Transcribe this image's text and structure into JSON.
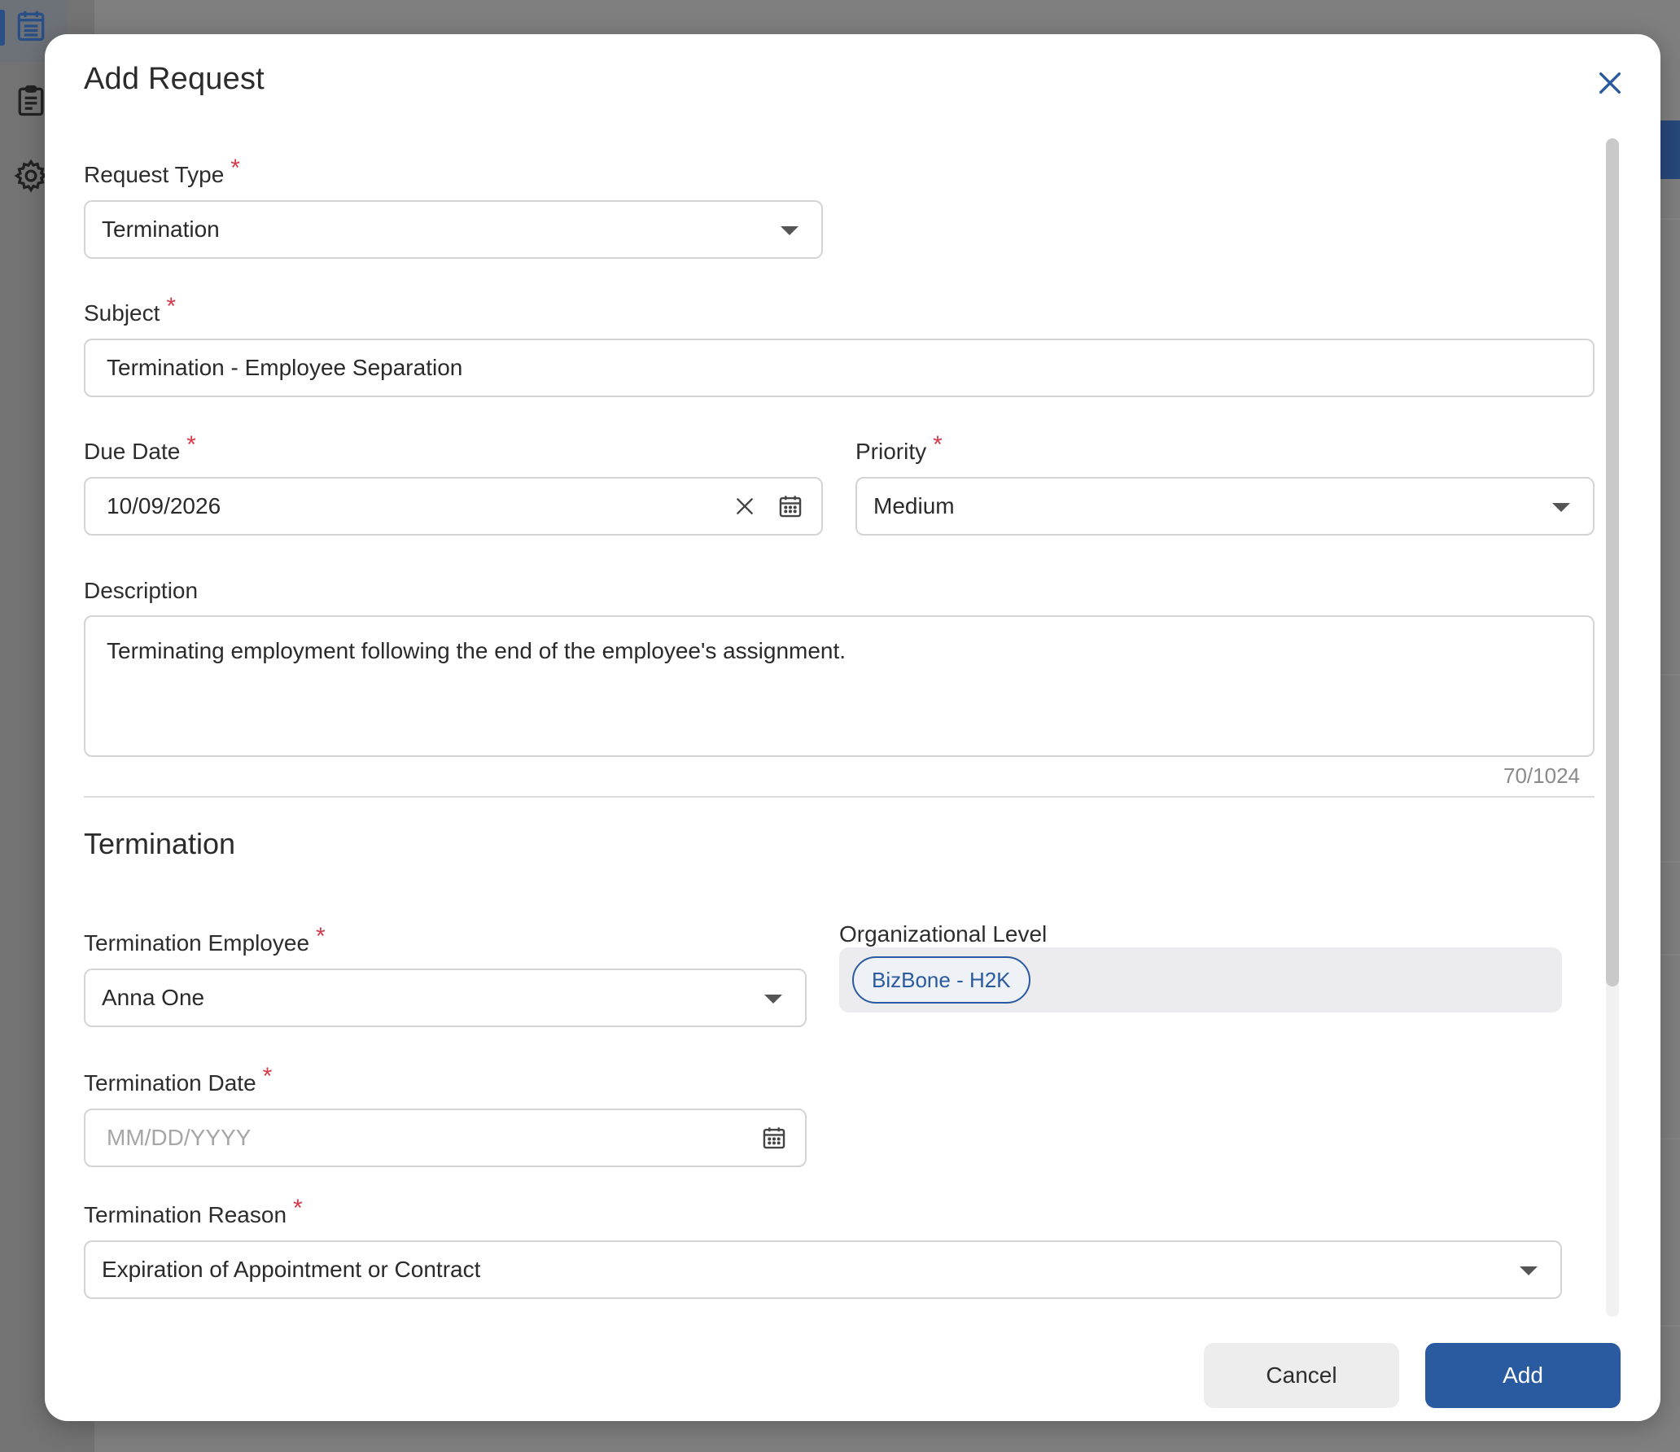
{
  "modal": {
    "title": "Add Request",
    "close_label": "close"
  },
  "fields": {
    "request_type": {
      "label": "Request Type",
      "value": "Termination"
    },
    "subject": {
      "label": "Subject",
      "value": "Termination - Employee Separation"
    },
    "due_date": {
      "label": "Due Date",
      "value": "10/09/2026"
    },
    "priority": {
      "label": "Priority",
      "value": "Medium"
    },
    "description": {
      "label": "Description",
      "value": "Terminating employment following the end of the employee's assignment.",
      "counter": "70/1024"
    }
  },
  "termination": {
    "section_title": "Termination",
    "employee": {
      "label": "Termination Employee",
      "value": "Anna One"
    },
    "org_level": {
      "label": "Organizational Level",
      "chip": "BizBone - H2K"
    },
    "date": {
      "label": "Termination Date",
      "placeholder": "MM/DD/YYYY"
    },
    "reason": {
      "label": "Termination Reason",
      "value": "Expiration of Appointment or Contract"
    }
  },
  "actions": {
    "cancel_label": "Cancel",
    "add_label": "Add"
  },
  "colors": {
    "accent": "#2a5aa0",
    "required": "#d63a4a"
  },
  "icons": {
    "sidebar": [
      "calendar-list-icon",
      "clipboard-icon",
      "gear-icon"
    ],
    "modal": [
      "close-icon",
      "clear-icon",
      "calendar-icon",
      "chevron-down-icon"
    ]
  }
}
